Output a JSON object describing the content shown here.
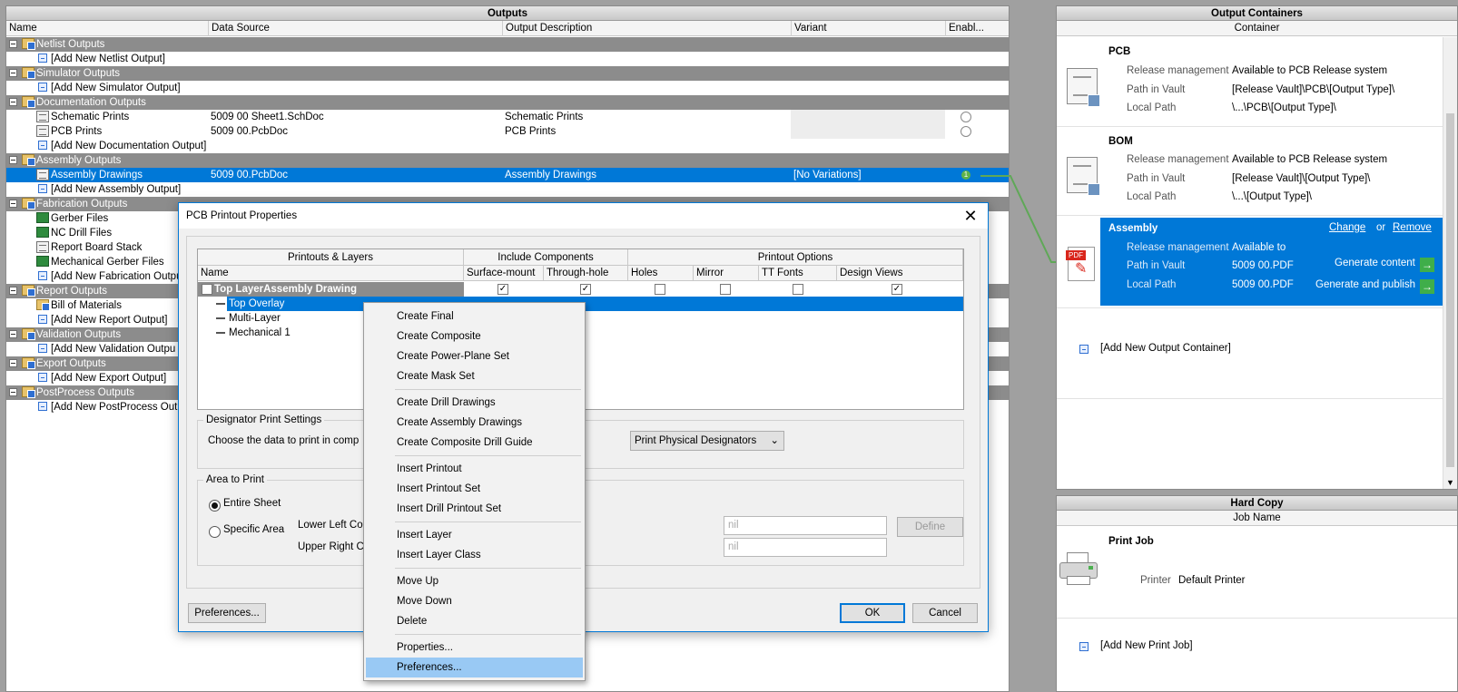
{
  "outputs": {
    "title": "Outputs",
    "columns": [
      "Name",
      "Data Source",
      "Output Description",
      "Variant",
      "Enabl..."
    ],
    "groups": {
      "netlist": "Netlist Outputs",
      "add_netlist": "[Add New Netlist Output]",
      "simulator": "Simulator Outputs",
      "add_simulator": "[Add New Simulator Output]",
      "documentation": "Documentation Outputs",
      "schematic_prints": {
        "name": "Schematic Prints",
        "source": "5009 00 Sheet1.SchDoc",
        "desc": "Schematic Prints"
      },
      "pcb_prints": {
        "name": "PCB Prints",
        "source": "5009 00.PcbDoc",
        "desc": "PCB Prints"
      },
      "add_documentation": "[Add New Documentation Output]",
      "assembly": "Assembly Outputs",
      "assembly_drawings": {
        "name": "Assembly Drawings",
        "source": "5009 00.PcbDoc",
        "desc": "Assembly Drawings",
        "variant": "[No Variations]",
        "enabled": "1"
      },
      "add_assembly": "[Add New Assembly Output]",
      "fabrication": "Fabrication Outputs",
      "gerber": "Gerber Files",
      "nc_drill": "NC Drill Files",
      "report_stack": "Report Board Stack",
      "mech_gerber": "Mechanical Gerber Files",
      "add_fabrication": "[Add New Fabrication Outpu",
      "report": "Report Outputs",
      "bom": "Bill of Materials",
      "add_report": "[Add New Report Output]",
      "validation": "Validation Outputs",
      "add_validation": "[Add New Validation Outpu",
      "export": "Export Outputs",
      "add_export": "[Add New Export Output]",
      "postprocess": "PostProcess Outputs",
      "add_postprocess": "[Add New PostProcess Outp"
    }
  },
  "containers": {
    "title": "Output Containers",
    "column": "Container",
    "pcb": {
      "title": "PCB",
      "release_label": "Release management",
      "release": "Available to PCB Release system",
      "vault_label": "Path in Vault",
      "vault": "[Release Vault]\\PCB\\[Output Type]\\",
      "local_label": "Local Path",
      "local": "\\...\\PCB\\[Output Type]\\"
    },
    "bom": {
      "title": "BOM",
      "release_label": "Release management",
      "release": "Available to PCB Release system",
      "vault_label": "Path in Vault",
      "vault": "[Release Vault]\\[Output Type]\\",
      "local_label": "Local Path",
      "local": "\\...\\[Output Type]\\"
    },
    "assembly": {
      "title": "Assembly",
      "change": "Change",
      "or": "or",
      "remove": "Remove",
      "release_label": "Release management",
      "release": "Available to",
      "vault_label": "Path in Vault",
      "vault": "5009 00.PDF",
      "local_label": "Local Path",
      "local": "5009 00.PDF",
      "gen_content": "Generate content",
      "gen_publish": "Generate and publish",
      "pdf_text": "PDF"
    },
    "add": "[Add New Output Container]"
  },
  "hardcopy": {
    "title": "Hard Copy",
    "column": "Job Name",
    "job_title": "Print Job",
    "printer_label": "Printer",
    "printer": "Default Printer",
    "add": "[Add New Print Job]"
  },
  "dialog": {
    "title": "PCB Printout Properties",
    "close": "✕",
    "hdr_printouts": "Printouts & Layers",
    "hdr_include": "Include Components",
    "hdr_options": "Printout Options",
    "col_name": "Name",
    "col_surface": "Surface-mount",
    "col_through": "Through-hole",
    "col_holes": "Holes",
    "col_mirror": "Mirror",
    "col_ttfonts": "TT Fonts",
    "col_design": "Design Views",
    "printout": "Top LayerAssembly Drawing",
    "layers": [
      "Top Overlay",
      "Multi-Layer",
      "Mechanical 1"
    ],
    "designator_legend": "Designator Print Settings",
    "designator_text": "Choose the data to print in comp",
    "designator_combo": "Print Physical Designators",
    "area_legend": "Area to Print",
    "entire": "Entire Sheet",
    "specific": "Specific Area",
    "lower_left": "Lower Left Co",
    "upper_right": "Upper Right C",
    "mil1": "nil",
    "mil2": "nil",
    "define": "Define",
    "preferences": "Preferences...",
    "ok": "OK",
    "cancel": "Cancel"
  },
  "menu": {
    "items": [
      "Create Final",
      "Create Composite",
      "Create Power-Plane Set",
      "Create Mask Set",
      "Create Drill Drawings",
      "Create Assembly Drawings",
      "Create Composite Drill Guide",
      "Insert Printout",
      "Insert Printout Set",
      "Insert Drill Printout Set",
      "Insert Layer",
      "Insert Layer Class",
      "Move Up",
      "Move Down",
      "Delete",
      "Properties...",
      "Preferences..."
    ]
  }
}
